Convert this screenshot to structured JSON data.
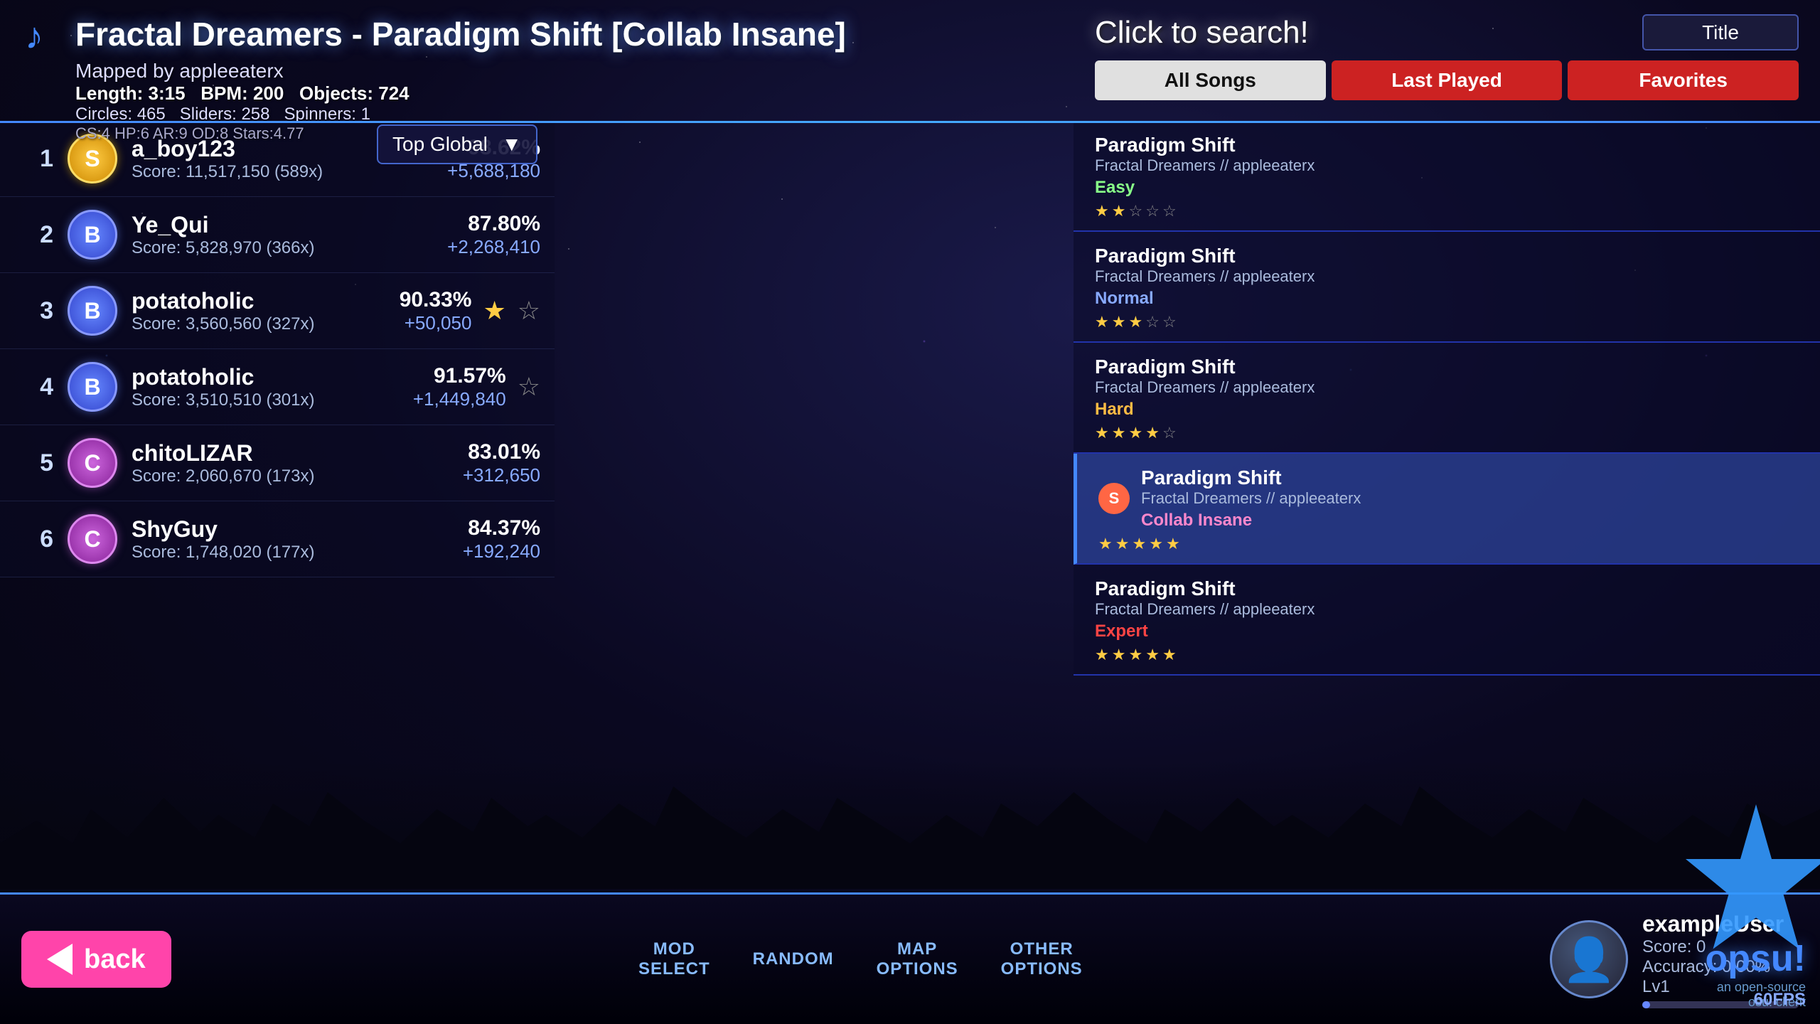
{
  "header": {
    "music_icon": "♪",
    "song_title": "Fractal Dreamers - Paradigm Shift [Collab Insane]",
    "mapped_by": "Mapped by appleeaterx",
    "length_label": "Length:",
    "length_value": "3:15",
    "bpm_label": "BPM:",
    "bpm_value": "200",
    "objects_label": "Objects:",
    "objects_value": "724",
    "circles_label": "Circles:",
    "circles_value": "465",
    "sliders_label": "Sliders:",
    "sliders_value": "258",
    "spinners_label": "Spinners:",
    "spinners_value": "1",
    "cs_info": "CS:4 HP:6 AR:9 OD:8 Stars:4.77"
  },
  "search": {
    "click_to_search": "Click to search!",
    "title_dropdown": "Title",
    "filter_all_songs": "All Songs",
    "filter_last_played": "Last Played",
    "filter_favorites": "Favorites"
  },
  "leaderboard": {
    "dropdown_label": "Top Global",
    "entries": [
      {
        "rank": "1",
        "grade": "S",
        "grade_class": "grade-s",
        "player": "a_boy123",
        "score_text": "Score: 11,517,150 (589x)",
        "accuracy": "98.62%",
        "pp": "+5,688,180",
        "star_filled": true
      },
      {
        "rank": "2",
        "grade": "B",
        "grade_class": "grade-b",
        "player": "Ye_Qui",
        "score_text": "Score: 5,828,970 (366x)",
        "accuracy": "87.80%",
        "pp": "+2,268,410",
        "star_filled": false
      },
      {
        "rank": "3",
        "grade": "B",
        "grade_class": "grade-b",
        "player": "potatoholic",
        "score_text": "Score: 3,560,560 (327x)",
        "accuracy": "90.33%",
        "pp": "+50,050",
        "star_filled": true,
        "star_empty": true
      },
      {
        "rank": "4",
        "grade": "B",
        "grade_class": "grade-b",
        "player": "potatoholic",
        "score_text": "Score: 3,510,510 (301x)",
        "accuracy": "91.57%",
        "pp": "+1,449,840",
        "star_filled": false,
        "star_empty": true
      },
      {
        "rank": "5",
        "grade": "C",
        "grade_class": "grade-c",
        "player": "chitoLIZAR",
        "score_text": "Score: 2,060,670 (173x)",
        "accuracy": "83.01%",
        "pp": "+312,650",
        "star_filled": false
      },
      {
        "rank": "6",
        "grade": "C",
        "grade_class": "grade-c",
        "player": "ShyGuy",
        "score_text": "Score: 1,748,020 (177x)",
        "accuracy": "84.37%",
        "pp": "+192,240",
        "star_filled": false
      }
    ]
  },
  "song_list": {
    "items": [
      {
        "name": "Paradigm Shift",
        "creator": "Fractal Dreamers // appleeaterx",
        "difficulty": "Easy",
        "diff_class": "diff-easy",
        "active": false,
        "badge": "",
        "stars": [
          true,
          true,
          false,
          false,
          false
        ]
      },
      {
        "name": "Paradigm Shift",
        "creator": "Fractal Dreamers // appleeaterx",
        "difficulty": "Normal",
        "diff_class": "diff-normal",
        "active": false,
        "badge": "",
        "stars": [
          true,
          true,
          true,
          false,
          false
        ]
      },
      {
        "name": "Paradigm Shift",
        "creator": "Fractal Dreamers // appleeaterx",
        "difficulty": "Hard",
        "diff_class": "diff-hard",
        "active": false,
        "badge": "",
        "stars": [
          true,
          true,
          true,
          true,
          false
        ]
      },
      {
        "name": "Paradigm Shift",
        "creator": "Fractal Dreamers // appleeaterx",
        "difficulty": "Collab Insane",
        "diff_class": "diff-insane",
        "active": true,
        "badge": "S",
        "stars": [
          true,
          true,
          true,
          true,
          true
        ]
      },
      {
        "name": "Paradigm Shift",
        "creator": "Fractal Dreamers // appleeaterx",
        "difficulty": "Expert",
        "diff_class": "diff-expert",
        "active": false,
        "badge": "",
        "stars": [
          true,
          true,
          true,
          true,
          true
        ]
      }
    ]
  },
  "bottom_bar": {
    "back_label": "back",
    "mod_select_line1": "MOD",
    "mod_select_line2": "SELECT",
    "random_line1": "RANDOM",
    "random_line2": "",
    "map_options_line1": "MAP",
    "map_options_line2": "OPTIONS",
    "other_options_line1": "OTHER",
    "other_options_line2": "OPTIONS",
    "username": "exampleUser",
    "score": "Score: 0",
    "accuracy": "Accuracy: 0.00%",
    "level": "Lv1"
  },
  "opsu": {
    "text": "opsu!",
    "sub1": "an open-source",
    "sub2": "osu! client",
    "fps": "60FPS"
  }
}
